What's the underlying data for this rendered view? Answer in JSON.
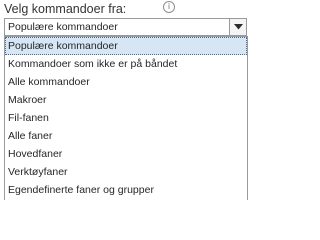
{
  "label": "Velg kommandoer fra:",
  "info_icon": "info-icon",
  "combo": {
    "value": "Populære kommandoer",
    "button_icon": "chevron-down-icon"
  },
  "options": [
    "Populære kommandoer",
    "Kommandoer som ikke er på båndet",
    "Alle kommandoer",
    "Makroer",
    "Fil-fanen",
    "Alle faner",
    "Hovedfaner",
    "Verktøyfaner",
    "Egendefinerte faner og grupper"
  ],
  "selected_index": 0,
  "colors": {
    "selected_bg": "#d6e6f5",
    "border": "#9a9a9a"
  }
}
